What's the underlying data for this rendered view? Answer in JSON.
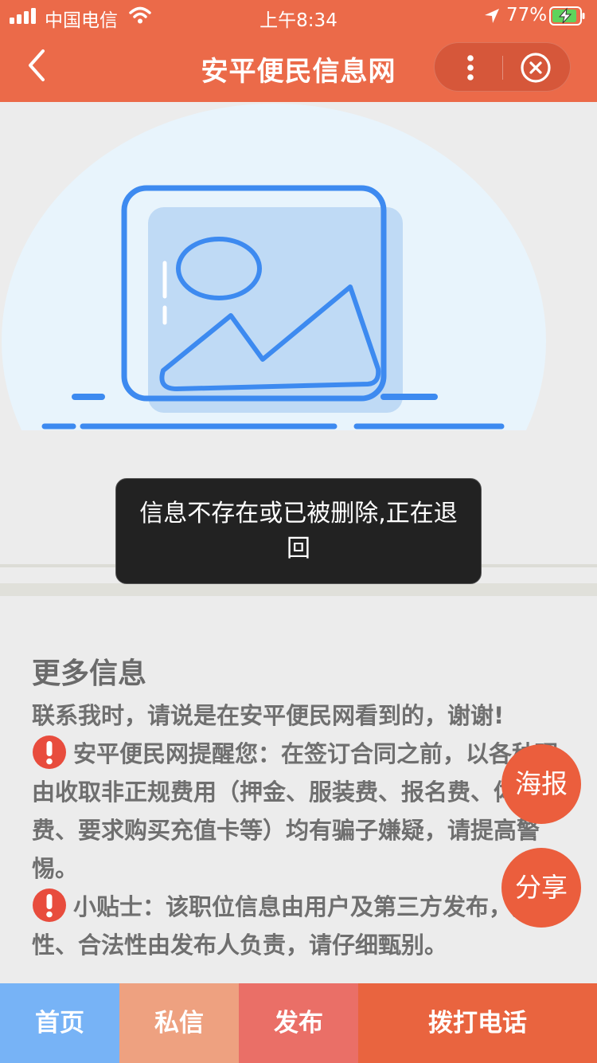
{
  "status_bar": {
    "carrier": "中国电信",
    "time": "上午8:34",
    "battery": "77%"
  },
  "nav": {
    "title": "安平便民信息网"
  },
  "toast": {
    "message": "信息不存在或已被删除,正在退回"
  },
  "more_info": {
    "title": "更多信息",
    "contact_note": "联系我时，请说是在安平便民网看到的，谢谢!",
    "warning_1": "安平便民网提醒您：在签订合同之前，以各种理由收取非正规费用（押金、服装费、报名费、体检费、要求购买充值卡等）均有骗子嫌疑，请提高警惕。",
    "warning_2": "小贴士：该职位信息由用户及第三方发布，真实性、合法性由发布人负责，请仔细甄别。"
  },
  "float_buttons": {
    "poster": "海报",
    "share": "分享"
  },
  "tabbar": {
    "home": "首页",
    "message": "私信",
    "publish": "发布",
    "call": "拨打电话"
  },
  "colors": {
    "header_bg": "#eb6a49",
    "tab_home": "#77b3f6",
    "tab_message": "#eea180",
    "tab_publish": "#ea6f67",
    "tab_call": "#e9643f",
    "float_button": "#eb5e3d",
    "illustration_blue": "#3d8af0"
  },
  "icons": {
    "signal": "signal-icon",
    "wifi": "wifi-icon",
    "location": "location-arrow-icon",
    "battery": "battery-charging-icon",
    "back": "chevron-left-icon",
    "more": "more-vertical-icon",
    "close": "close-circle-icon",
    "warning": "exclamation-circle-icon",
    "empty_image": "image-placeholder-icon"
  }
}
